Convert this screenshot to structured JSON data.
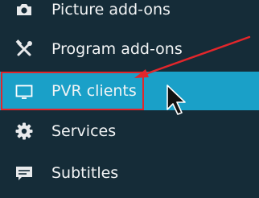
{
  "menu": {
    "items": [
      {
        "label": "Picture add-ons",
        "icon": "camera-icon"
      },
      {
        "label": "Program add-ons",
        "icon": "tools-icon"
      },
      {
        "label": "PVR clients",
        "icon": "tv-icon",
        "selected": true
      },
      {
        "label": "Services",
        "icon": "gear-icon"
      },
      {
        "label": "Subtitles",
        "icon": "subtitles-icon"
      }
    ]
  },
  "colors": {
    "background": "#152c38",
    "selected": "#1aa0c8",
    "annotation": "#e2262b",
    "text": "#f2f4f5"
  }
}
